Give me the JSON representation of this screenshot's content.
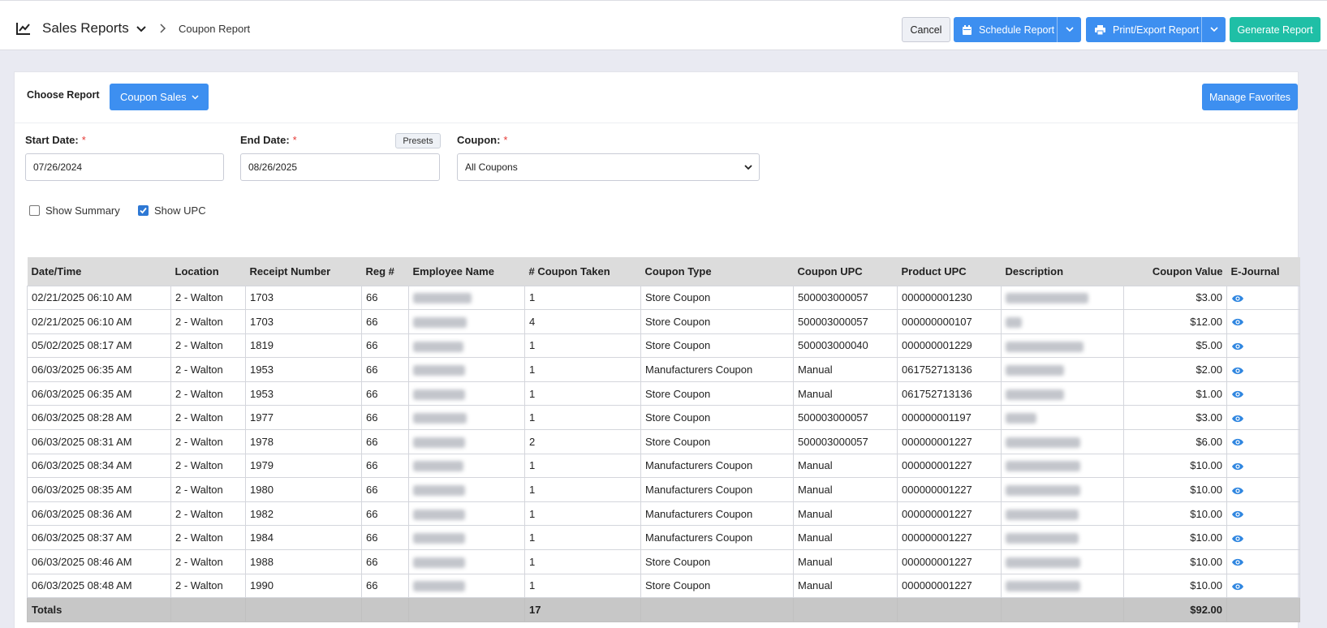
{
  "header": {
    "title": "Sales Reports",
    "breadcrumb": "Coupon Report",
    "cancel_label": "Cancel",
    "schedule_label": "Schedule Report",
    "print_label": "Print/Export Report",
    "generate_label": "Generate Report"
  },
  "controls": {
    "choose_report_label": "Choose Report",
    "report_selected": "Coupon Sales",
    "manage_favorites_label": "Manage Favorites",
    "start_date_label": "Start Date:",
    "start_date_value": "07/26/2024",
    "end_date_label": "End Date:",
    "end_date_value": "08/26/2025",
    "presets_label": "Presets",
    "coupon_label": "Coupon:",
    "coupon_value": "All Coupons",
    "required_mark": "*",
    "show_summary_label": "Show Summary",
    "show_summary_checked": false,
    "show_upc_label": "Show UPC",
    "show_upc_checked": true
  },
  "table": {
    "columns": [
      "Date/Time",
      "Location",
      "Receipt Number",
      "Reg #",
      "Employee Name",
      "# Coupon Taken",
      "Coupon Type",
      "Coupon UPC",
      "Product UPC",
      "Description",
      "Coupon Value",
      "E-Journal"
    ],
    "rows": [
      [
        "02/21/2025 06:10 AM",
        "2 - Walton",
        "1703",
        "66",
        "",
        "1",
        "Store Coupon",
        "500003000057",
        "000000001230",
        "",
        "$3.00"
      ],
      [
        "02/21/2025 06:10 AM",
        "2 - Walton",
        "1703",
        "66",
        "",
        "4",
        "Store Coupon",
        "500003000057",
        "000000000107",
        "",
        "$12.00"
      ],
      [
        "05/02/2025 08:17 AM",
        "2 - Walton",
        "1819",
        "66",
        "",
        "1",
        "Store Coupon",
        "500003000040",
        "000000001229",
        "",
        "$5.00"
      ],
      [
        "06/03/2025 06:35 AM",
        "2 - Walton",
        "1953",
        "66",
        "",
        "1",
        "Manufacturers Coupon",
        "Manual",
        "061752713136",
        "",
        "$2.00"
      ],
      [
        "06/03/2025 06:35 AM",
        "2 - Walton",
        "1953",
        "66",
        "",
        "1",
        "Store Coupon",
        "Manual",
        "061752713136",
        "",
        "$1.00"
      ],
      [
        "06/03/2025 08:28 AM",
        "2 - Walton",
        "1977",
        "66",
        "",
        "1",
        "Store Coupon",
        "500003000057",
        "000000001197",
        "",
        "$3.00"
      ],
      [
        "06/03/2025 08:31 AM",
        "2 - Walton",
        "1978",
        "66",
        "",
        "2",
        "Store Coupon",
        "500003000057",
        "000000001227",
        "",
        "$6.00"
      ],
      [
        "06/03/2025 08:34 AM",
        "2 - Walton",
        "1979",
        "66",
        "",
        "1",
        "Manufacturers Coupon",
        "Manual",
        "000000001227",
        "",
        "$10.00"
      ],
      [
        "06/03/2025 08:35 AM",
        "2 - Walton",
        "1980",
        "66",
        "",
        "1",
        "Manufacturers Coupon",
        "Manual",
        "000000001227",
        "",
        "$10.00"
      ],
      [
        "06/03/2025 08:36 AM",
        "2 - Walton",
        "1982",
        "66",
        "",
        "1",
        "Manufacturers Coupon",
        "Manual",
        "000000001227",
        "",
        "$10.00"
      ],
      [
        "06/03/2025 08:37 AM",
        "2 - Walton",
        "1984",
        "66",
        "",
        "1",
        "Manufacturers Coupon",
        "Manual",
        "000000001227",
        "",
        "$10.00"
      ],
      [
        "06/03/2025 08:46 AM",
        "2 - Walton",
        "1988",
        "66",
        "",
        "1",
        "Store Coupon",
        "Manual",
        "000000001227",
        "",
        "$10.00"
      ],
      [
        "06/03/2025 08:48 AM",
        "2 - Walton",
        "1990",
        "66",
        "",
        "1",
        "Store Coupon",
        "Manual",
        "000000001227",
        "",
        "$10.00"
      ]
    ],
    "totals": {
      "label": "Totals",
      "coupons": "17",
      "value": "$92.00"
    }
  },
  "icons": {
    "chart": "line-chart-icon",
    "calendar": "calendar-icon",
    "printer": "printer-icon",
    "eye": "eye-icon"
  },
  "colors": {
    "primary_blue": "#3d8ff0",
    "teal": "#1fbfa6",
    "required": "#e53935",
    "table_header": "#dcdcdc",
    "totals_row": "#c7c7c7",
    "page_bg": "#e9eaf2"
  }
}
